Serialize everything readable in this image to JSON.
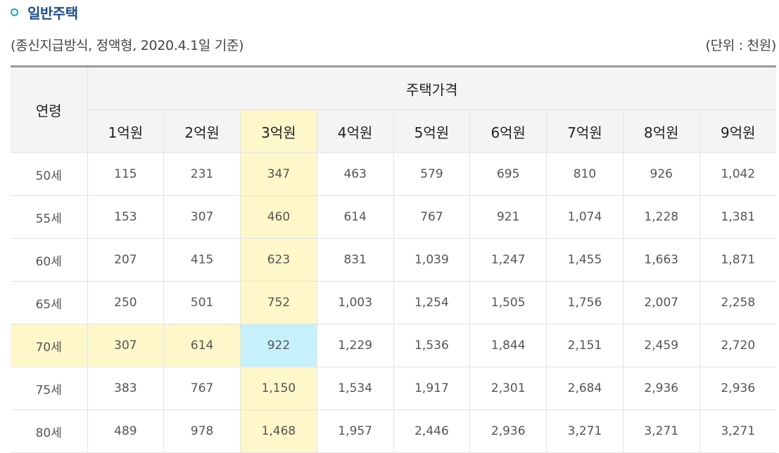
{
  "section": {
    "title": "일반주택"
  },
  "meta": {
    "basis": "(종신지급방식, 정액형, 2020.4.1일 기준)",
    "unit": "(단위 : 천원)"
  },
  "table": {
    "age_header": "연령",
    "price_header": "주택가격",
    "price_columns": [
      "1억원",
      "2억원",
      "3억원",
      "4억원",
      "5억원",
      "6억원",
      "7억원",
      "8억원",
      "9억원"
    ],
    "rows": [
      {
        "age": "50세",
        "values": [
          "115",
          "231",
          "347",
          "463",
          "579",
          "695",
          "810",
          "926",
          "1,042"
        ]
      },
      {
        "age": "55세",
        "values": [
          "153",
          "307",
          "460",
          "614",
          "767",
          "921",
          "1,074",
          "1,228",
          "1,381"
        ]
      },
      {
        "age": "60세",
        "values": [
          "207",
          "415",
          "623",
          "831",
          "1,039",
          "1,247",
          "1,455",
          "1,663",
          "1,871"
        ]
      },
      {
        "age": "65세",
        "values": [
          "250",
          "501",
          "752",
          "1,003",
          "1,254",
          "1,505",
          "1,756",
          "2,007",
          "2,258"
        ]
      },
      {
        "age": "70세",
        "values": [
          "307",
          "614",
          "922",
          "1,229",
          "1,536",
          "1,844",
          "2,151",
          "2,459",
          "2,720"
        ]
      },
      {
        "age": "75세",
        "values": [
          "383",
          "767",
          "1,150",
          "1,534",
          "1,917",
          "2,301",
          "2,684",
          "2,936",
          "2,936"
        ]
      },
      {
        "age": "80세",
        "values": [
          "489",
          "978",
          "1,468",
          "1,957",
          "2,446",
          "2,936",
          "3,271",
          "3,271",
          "3,271"
        ]
      }
    ],
    "highlight": {
      "column_color": "#fdf7c9",
      "row_color": "#fdf7c9",
      "intersection_color": "#c6f1fb"
    }
  }
}
